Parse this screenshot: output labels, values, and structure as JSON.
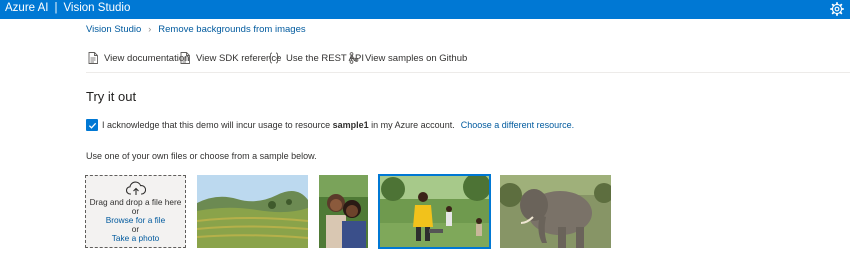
{
  "header": {
    "brand_primary": "Azure AI",
    "brand_divider": "|",
    "brand_secondary": "Vision Studio",
    "settings_icon": "gear-icon"
  },
  "breadcrumb": {
    "root": "Vision Studio",
    "current": "Remove backgrounds from images"
  },
  "resource_links": [
    {
      "label": "View documentation",
      "icon": "document-icon"
    },
    {
      "label": "View SDK reference",
      "icon": "sdk-document-icon"
    },
    {
      "label": "Use the REST API",
      "icon": "braces-icon"
    },
    {
      "label": "View samples on Github",
      "icon": "branch-icon"
    }
  ],
  "try_it_out": {
    "heading": "Try it out",
    "acknowledge": {
      "checked": true,
      "text_before": "I acknowledge that this demo will incur usage to resource ",
      "resource": "sample1",
      "text_after": " in my Azure account.",
      "change_link": "Choose a different resource."
    },
    "instructions": "Use one of your own files or choose from a sample below.",
    "upload": {
      "icon": "cloud-upload-icon",
      "line1": "Drag and drop a file here",
      "or1": "or",
      "browse": "Browse for a file",
      "or2": "or",
      "camera": "Take a photo"
    },
    "samples": [
      {
        "subject": "landscape with terraced fields",
        "selected": false
      },
      {
        "subject": "smiling couple portrait",
        "selected": false
      },
      {
        "subject": "man in yellow apron grilling outdoors",
        "selected": true
      },
      {
        "subject": "elephant in grassland",
        "selected": false
      }
    ]
  },
  "colors": {
    "accent": "#0078d4",
    "link": "#005a9e",
    "text": "#323130"
  }
}
